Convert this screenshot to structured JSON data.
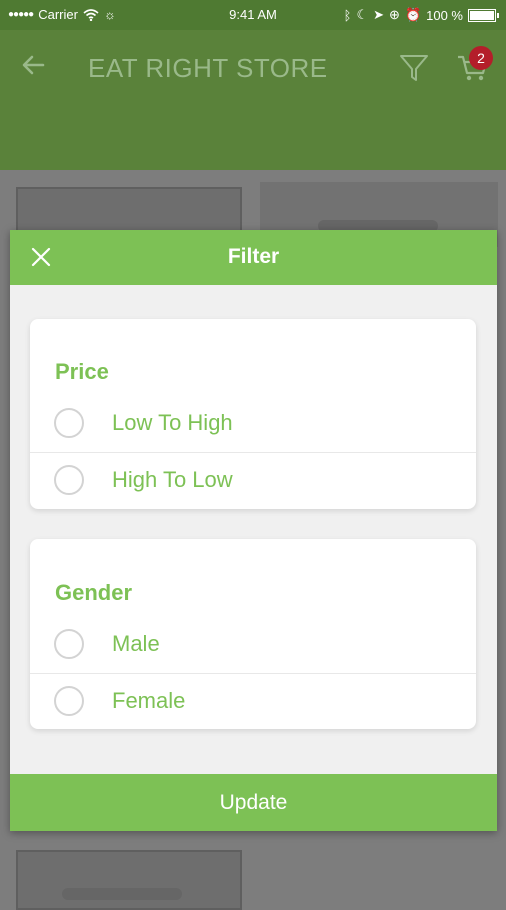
{
  "status_bar": {
    "carrier": "Carrier",
    "time": "9:41 AM",
    "battery": "100 %"
  },
  "app_bar": {
    "title": "EAT RIGHT STORE",
    "cart_count": "2"
  },
  "filter_dialog": {
    "title": "Filter",
    "sections": [
      {
        "title": "Price",
        "options": [
          "Low To High",
          "High To Low"
        ]
      },
      {
        "title": "Gender",
        "options": [
          "Male",
          "Female"
        ]
      }
    ],
    "update_label": "Update"
  },
  "colors": {
    "accent_green": "#7dc155",
    "appbar_green": "#5a823a",
    "badge_red": "#b41e2a"
  }
}
